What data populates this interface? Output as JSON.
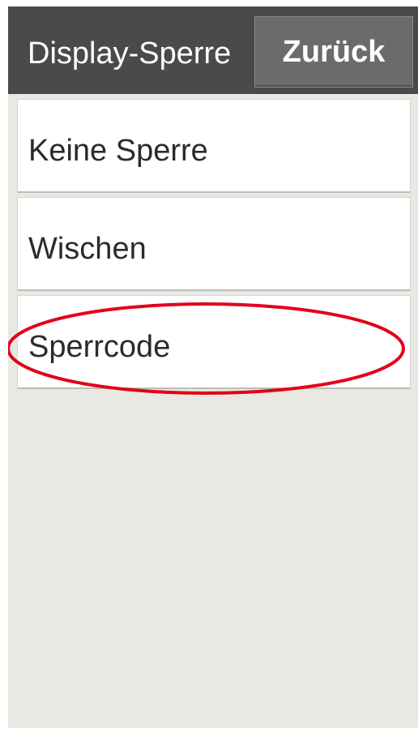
{
  "header": {
    "title": "Display-Sperre",
    "back_label": "Zurück"
  },
  "lock_options": [
    {
      "label": "Keine Sperre"
    },
    {
      "label": "Wischen"
    },
    {
      "label": "Sperrcode"
    }
  ],
  "annotation": {
    "highlighted_option": "Sperrcode",
    "color": "#e3001b"
  },
  "colors": {
    "header_bg": "#4a4a4a",
    "button_bg": "#6b6b6b",
    "screen_bg": "#e9e9e4",
    "item_bg": "#ffffff"
  }
}
